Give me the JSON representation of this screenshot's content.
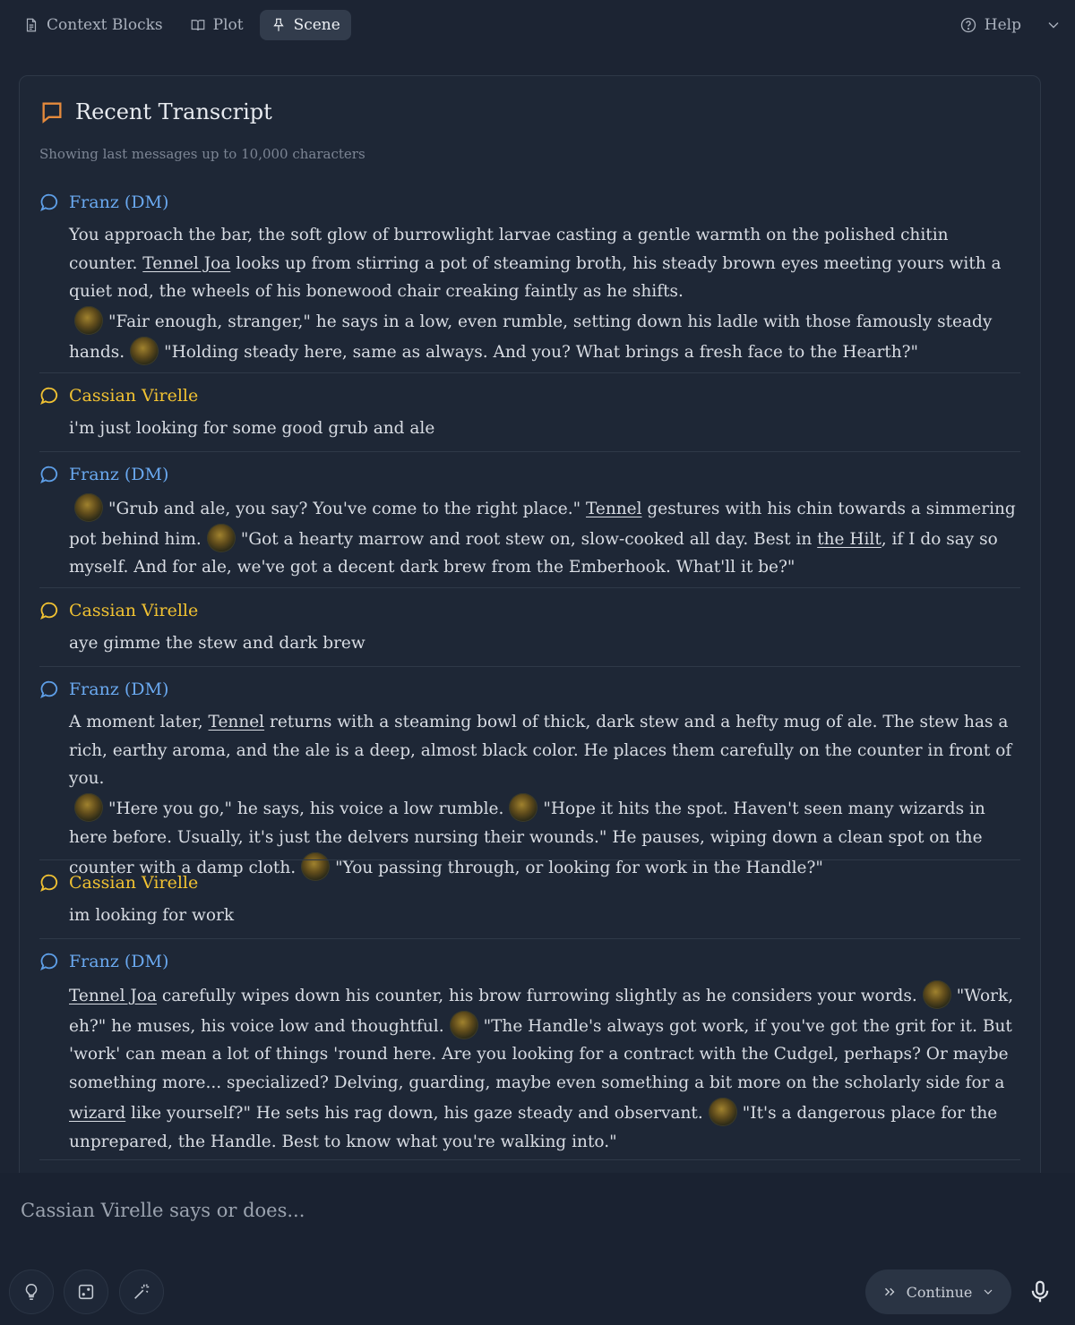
{
  "tabs": [
    {
      "label": "Context Blocks",
      "icon": "document-icon",
      "active": false
    },
    {
      "label": "Plot",
      "icon": "book-icon",
      "active": false
    },
    {
      "label": "Scene",
      "icon": "pin-icon",
      "active": true
    }
  ],
  "help_label": "Help",
  "card": {
    "title": "Recent Transcript",
    "subtitle": "Showing last messages up to 10,000 characters"
  },
  "messages": [
    {
      "speaker": "Franz (DM)",
      "role": "dm"
    },
    {
      "speaker": "Cassian Virelle",
      "role": "player",
      "text": "i'm just looking for some good grub and ale"
    },
    {
      "speaker": "Franz (DM)",
      "role": "dm"
    },
    {
      "speaker": "Cassian Virelle",
      "role": "player",
      "text": "aye gimme the stew and dark brew"
    },
    {
      "speaker": "Franz (DM)",
      "role": "dm"
    },
    {
      "speaker": "Cassian Virelle",
      "role": "player",
      "text": "im looking for work"
    },
    {
      "speaker": "Franz (DM)",
      "role": "dm"
    }
  ],
  "m0": {
    "t1": "You approach the bar, the soft glow of burrowlight larvae casting a gentle warmth on the polished chitin counter. ",
    "l1": "Tennel Joa",
    "t2": " looks up from stirring a pot of steaming broth, his steady brown eyes meeting yours with a quiet nod, the wheels of his bonewood chair creaking faintly as he shifts.",
    "q1": "\"Fair enough, stranger,\"",
    "t3": " he says in a low, even rumble, setting down his ladle with those famously steady hands.",
    "q2": "\"Holding steady here, same as always. And you? What brings a fresh face to the Hearth?\""
  },
  "m2": {
    "q1": "\"Grub and ale, you say? You've come to the right place.\"",
    "l1": "Tennel",
    "t1": " gestures with his chin towards a simmering pot behind him.",
    "q2": "\"Got a hearty marrow and root stew on, slow-cooked all day. Best in ",
    "l2": "the Hilt",
    "q3": ", if I do say so myself. And for ale, we've got a decent dark brew from the Emberhook. What'll it be?\""
  },
  "m4": {
    "t1": "A moment later, ",
    "l1": "Tennel",
    "t2": " returns with a steaming bowl of thick, dark stew and a hefty mug of ale. The stew has a rich, earthy aroma, and the ale is a deep, almost black color. He places them carefully on the counter in front of you.",
    "q1": "\"Here you go,\"",
    "t3": " he says, his voice a low rumble.",
    "q2": "\"Hope it hits the spot. Haven't seen many wizards in here before. Usually, it's just the delvers nursing their wounds.\"",
    "t4": " He pauses, wiping down a clean spot on the counter with a damp cloth.",
    "q3": "\"You passing through, or looking for work in the Handle?\""
  },
  "m6": {
    "l1": "Tennel Joa",
    "t1": " carefully wipes down his counter, his brow furrowing slightly as he considers your words.",
    "q1": "\"Work, eh?\"",
    "t2": " he muses, his voice low and thoughtful.",
    "q2": "\"The Handle's always got work, if you've got the grit for it. But 'work' can mean a lot of things 'round here. Are you looking for a contract with the Cudgel, perhaps? Or maybe something more... specialized? Delving, guarding, maybe even something a bit more on the scholarly side for a ",
    "l2": "wizard",
    "q3": " like yourself?\"",
    "t3": " He sets his rag down, his gaze steady and observant.",
    "q4": "\"It's a dangerous place for the unprepared, the Handle. Best to know what you're walking into.\""
  },
  "composer": {
    "placeholder": "Cassian Virelle says or does...",
    "continue_label": "Continue"
  },
  "colors": {
    "dm": "#6aa9f0",
    "player": "#f1c232",
    "accent": "#e58a3c"
  }
}
